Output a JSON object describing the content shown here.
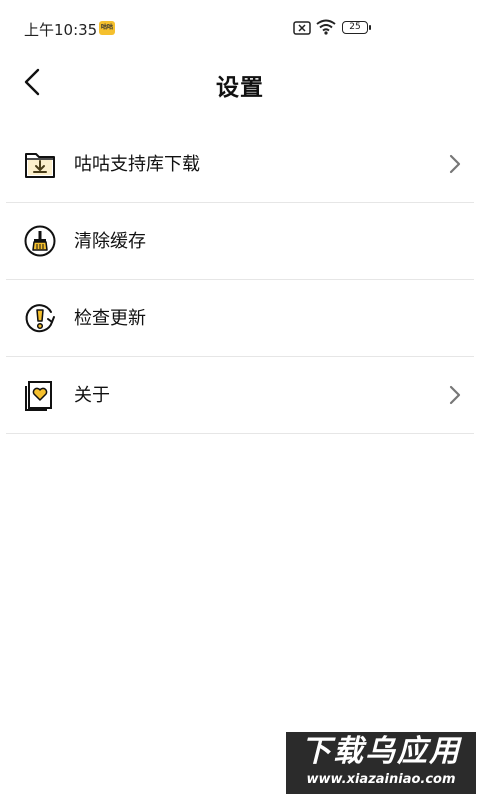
{
  "status_bar": {
    "time": "上午10:35",
    "app_badge": "咕咕",
    "battery": "25",
    "icons": [
      "sim-off-icon",
      "wifi-icon",
      "battery-icon"
    ]
  },
  "header": {
    "back_icon": "chevron-left-icon",
    "title": "设置"
  },
  "settings": {
    "items": [
      {
        "label": "咕咕支持库下载",
        "icon": "folder-download-icon",
        "has_arrow": true
      },
      {
        "label": "清除缓存",
        "icon": "broom-icon",
        "has_arrow": false
      },
      {
        "label": "检查更新",
        "icon": "update-icon",
        "has_arrow": false
      },
      {
        "label": "关于",
        "icon": "heart-book-icon",
        "has_arrow": true
      }
    ]
  },
  "watermark": {
    "main": "下载乌应用",
    "sub": "www.xiazainiao.com"
  },
  "colors": {
    "accent": "#f5c02e",
    "divider": "#e6e6e6",
    "text": "#111111"
  }
}
